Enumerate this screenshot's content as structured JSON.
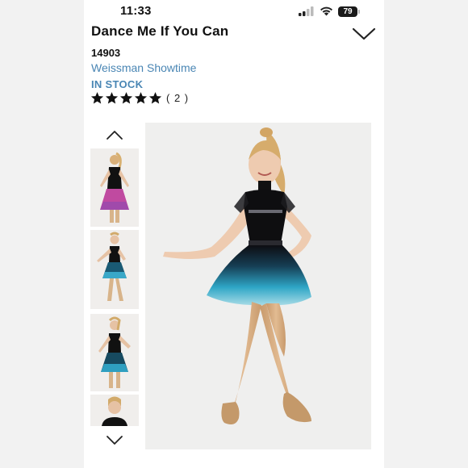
{
  "status_bar": {
    "time": "11:33",
    "battery": "79"
  },
  "product": {
    "title": "Dance Me If You Can",
    "sku": "14903",
    "brand": "Weissman Showtime",
    "stock_status": "IN STOCK",
    "rating": 5,
    "review_count": "( 2 )"
  },
  "icons": {
    "collapse": "chevron-down-icon",
    "thumb_prev": "chevron-up-icon",
    "thumb_next": "chevron-down-icon",
    "star": "star-icon",
    "wifi": "wifi-icon",
    "signal": "signal-icon"
  },
  "gallery": {
    "thumbnails": [
      {
        "view": "back",
        "skirt_color": "#c04aa0"
      },
      {
        "view": "front",
        "skirt_color": "#3aa8c8"
      },
      {
        "view": "front-posed",
        "skirt_color": "#2f9fc0"
      },
      {
        "view": "close-up",
        "skirt_color": "#2f9fc0"
      }
    ],
    "selected_index": 1
  },
  "colors": {
    "accent_blue": "#4a86b4",
    "costume_black": "#111111",
    "skirt_teal": "#3aa8c8",
    "skirt_pink": "#c04aa0",
    "tights": "#d8b48a"
  }
}
